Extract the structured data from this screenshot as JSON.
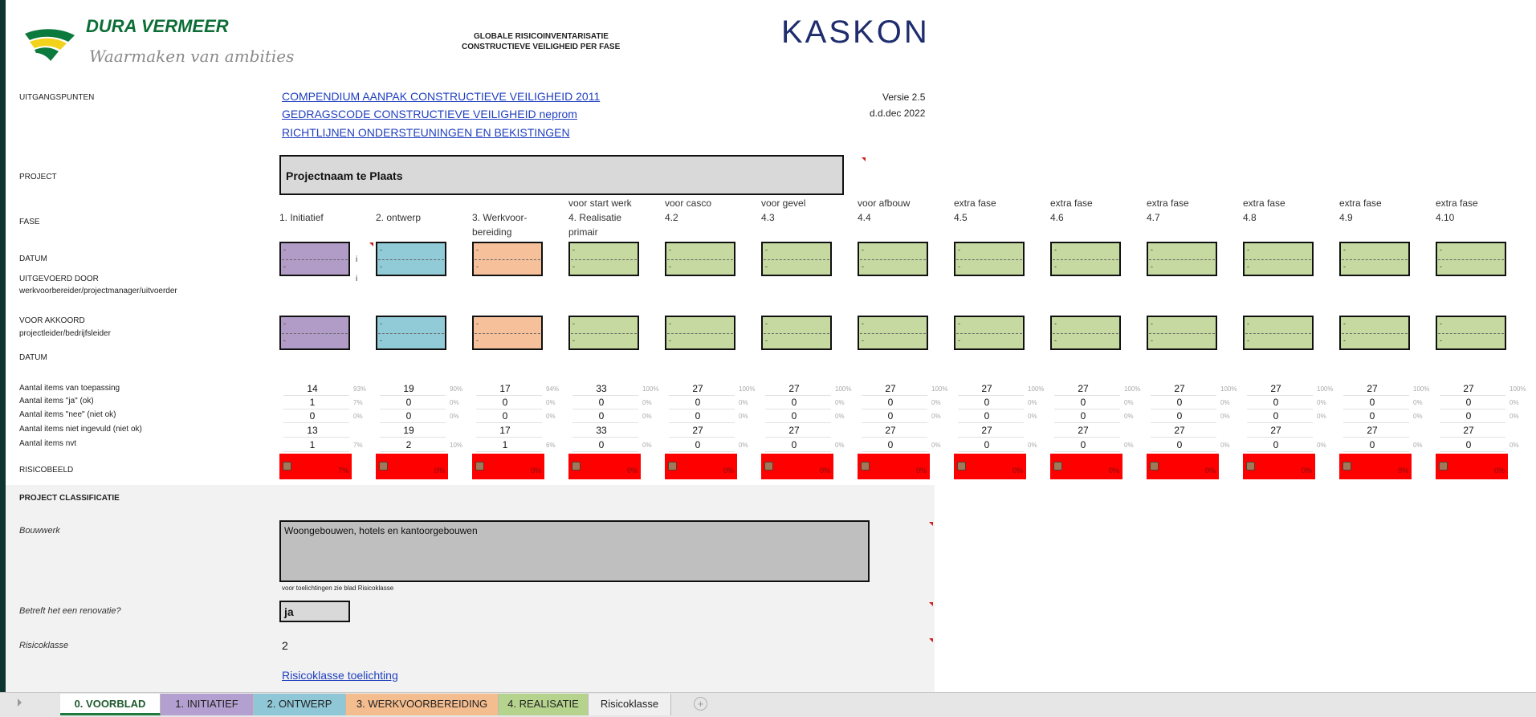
{
  "brand": {
    "name": "DURA VERMEER",
    "tagline": "Waarmaken van ambities",
    "kaskon": "KASKON"
  },
  "doc": {
    "title1": "GLOBALE RISICOINVENTARISATIE",
    "title2": "CONSTRUCTIEVE VEILIGHEID PER FASE",
    "version": "Versie 2.5",
    "date": "d.d.dec 2022"
  },
  "labels": {
    "uitgangspunten": "UITGANGSPUNTEN",
    "project": "PROJECT",
    "fase": "FASE",
    "datum1": "DATUM",
    "uitgevoerd": "UITGEVOERD DOOR",
    "uitgevoerd_sub": "werkvoorbereider/projectmanager/uitvoerder",
    "akkoord": "VOOR AKKOORD",
    "akkoord_sub": "projectleider/bedrijfsleider",
    "datum2": "DATUM",
    "toepassing": "Aantal items van toepassing",
    "ja": "Aantal items \"ja\" (ok)",
    "nee": "Aantal items \"nee\" (niet ok)",
    "niet_ingevuld": "Aantal items niet ingevuld (niet ok)",
    "nvt": "Aantal items nvt",
    "risicobeeld": "RISICOBEELD"
  },
  "links": [
    "COMPENDIUM AANPAK CONSTRUCTIEVE VEILIGHEID 2011",
    "GEDRAGSCODE CONSTRUCTIEVE VEILIGHEID neprom",
    "RICHTLIJNEN ONDERSTEUNINGEN EN BEKISTINGEN"
  ],
  "project_name": "Projectnaam te Plaats",
  "phases": [
    {
      "line1": "",
      "line2": "1. Initiatief",
      "line3": "",
      "color": "purple",
      "stats": [
        "14",
        "1",
        "0",
        "13",
        "1"
      ],
      "pcts": [
        "93%",
        "7%",
        "0%",
        "",
        "7%"
      ],
      "risk": "7%"
    },
    {
      "line1": "",
      "line2": "2. ontwerp",
      "line3": "",
      "color": "blue",
      "stats": [
        "19",
        "0",
        "0",
        "19",
        "2"
      ],
      "pcts": [
        "90%",
        "0%",
        "0%",
        "",
        "10%"
      ],
      "risk": "0%"
    },
    {
      "line1": "",
      "line2": "3. Werkvoor-",
      "line3": "bereiding",
      "color": "orange",
      "stats": [
        "17",
        "0",
        "0",
        "17",
        "1"
      ],
      "pcts": [
        "94%",
        "0%",
        "0%",
        "",
        "6%"
      ],
      "risk": "0%"
    },
    {
      "line1": "voor start werk",
      "line2": "4. Realisatie",
      "line3": "primair",
      "color": "green",
      "stats": [
        "33",
        "0",
        "0",
        "33",
        "0"
      ],
      "pcts": [
        "100%",
        "0%",
        "0%",
        "",
        "0%"
      ],
      "risk": "0%"
    },
    {
      "line1": "voor casco",
      "line2": "4.2",
      "line3": "",
      "color": "green",
      "stats": [
        "27",
        "0",
        "0",
        "27",
        "0"
      ],
      "pcts": [
        "100%",
        "0%",
        "0%",
        "",
        "0%"
      ],
      "risk": "0%"
    },
    {
      "line1": "voor gevel",
      "line2": "4.3",
      "line3": "",
      "color": "green",
      "stats": [
        "27",
        "0",
        "0",
        "27",
        "0"
      ],
      "pcts": [
        "100%",
        "0%",
        "0%",
        "",
        "0%"
      ],
      "risk": "0%"
    },
    {
      "line1": "voor afbouw",
      "line2": "4.4",
      "line3": "",
      "color": "green",
      "stats": [
        "27",
        "0",
        "0",
        "27",
        "0"
      ],
      "pcts": [
        "100%",
        "0%",
        "0%",
        "",
        "0%"
      ],
      "risk": "0%"
    },
    {
      "line1": "extra fase",
      "line2": "4.5",
      "line3": "",
      "color": "green",
      "stats": [
        "27",
        "0",
        "0",
        "27",
        "0"
      ],
      "pcts": [
        "100%",
        "0%",
        "0%",
        "",
        "0%"
      ],
      "risk": "0%"
    },
    {
      "line1": "extra fase",
      "line2": "4.6",
      "line3": "",
      "color": "green",
      "stats": [
        "27",
        "0",
        "0",
        "27",
        "0"
      ],
      "pcts": [
        "100%",
        "0%",
        "0%",
        "",
        "0%"
      ],
      "risk": "0%"
    },
    {
      "line1": "extra fase",
      "line2": "4.7",
      "line3": "",
      "color": "green",
      "stats": [
        "27",
        "0",
        "0",
        "27",
        "0"
      ],
      "pcts": [
        "100%",
        "0%",
        "0%",
        "",
        "0%"
      ],
      "risk": "0%"
    },
    {
      "line1": "extra fase",
      "line2": "4.8",
      "line3": "",
      "color": "green",
      "stats": [
        "27",
        "0",
        "0",
        "27",
        "0"
      ],
      "pcts": [
        "100%",
        "0%",
        "0%",
        "",
        "0%"
      ],
      "risk": "0%"
    },
    {
      "line1": "extra fase",
      "line2": "4.9",
      "line3": "",
      "color": "green",
      "stats": [
        "27",
        "0",
        "0",
        "27",
        "0"
      ],
      "pcts": [
        "100%",
        "0%",
        "0%",
        "",
        "0%"
      ],
      "risk": "0%"
    },
    {
      "line1": "extra fase",
      "line2": "4.10",
      "line3": "",
      "color": "green",
      "stats": [
        "27",
        "0",
        "0",
        "27",
        "0"
      ],
      "pcts": [
        "100%",
        "0%",
        "0%",
        "",
        "0%"
      ],
      "risk": "0%"
    }
  ],
  "box_placeholder": "-",
  "classificatie": {
    "title": "PROJECT CLASSIFICATIE",
    "bouwwerk_label": "Bouwwerk",
    "bouwwerk_value": "Woongebouwen, hotels en kantoorgebouwen",
    "note": "voor toelichtingen zie blad Risicoklasse",
    "renovatie_label": "Betreft het een renovatie?",
    "renovatie_value": "ja",
    "risicoklasse_label": "Risicoklasse",
    "risicoklasse_value": "2",
    "toelichting_link": "Risicoklasse toelichting"
  },
  "tabs": [
    {
      "label": "0. VOORBLAD",
      "color": "#ffff99",
      "active": true
    },
    {
      "label": "1. INITIATIEF",
      "color": "#b4a0d0"
    },
    {
      "label": "2. ONTWERP",
      "color": "#8fc7d6"
    },
    {
      "label": "3. WERKVOORBEREIDING",
      "color": "#f4bd8f"
    },
    {
      "label": "4. REALISATIE",
      "color": "#b5d38d"
    },
    {
      "label": "Risicoklasse",
      "color": "#f0f0f0"
    }
  ],
  "tab_add_symbol": "+"
}
